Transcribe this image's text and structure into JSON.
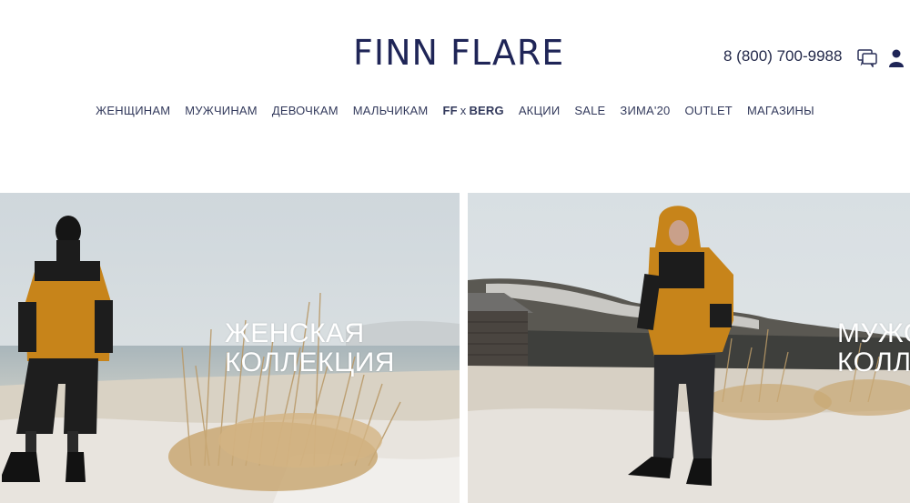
{
  "header": {
    "logo_text": "FINN FLARE",
    "phone": "8 (800) 700-9988",
    "chat_icon": "chat-icon",
    "user_icon": "user-icon"
  },
  "nav": {
    "items": [
      {
        "label": "ЖЕНЩИНАМ"
      },
      {
        "label": "МУЖЧИНАМ"
      },
      {
        "label": "ДЕВОЧКАМ"
      },
      {
        "label": "МАЛЬЧИКАМ"
      },
      {
        "label_a": "FF",
        "label_x": "x",
        "label_b": "BERG"
      },
      {
        "label": "АКЦИИ"
      },
      {
        "label": "SALE"
      },
      {
        "label": "ЗИМА'20"
      },
      {
        "label": "OUTLET"
      },
      {
        "label": "МАГАЗИНЫ"
      }
    ]
  },
  "hero": {
    "left": {
      "line1": "ЖЕНСКАЯ",
      "line2": "КОЛЛЕКЦИЯ"
    },
    "right": {
      "line1": "МУЖС",
      "line2": "КОЛЛ"
    }
  },
  "colors": {
    "brand": "#1f2557",
    "jacket": "#c7841a",
    "sky": "#d6dde2",
    "snow": "#e7e3dc"
  }
}
